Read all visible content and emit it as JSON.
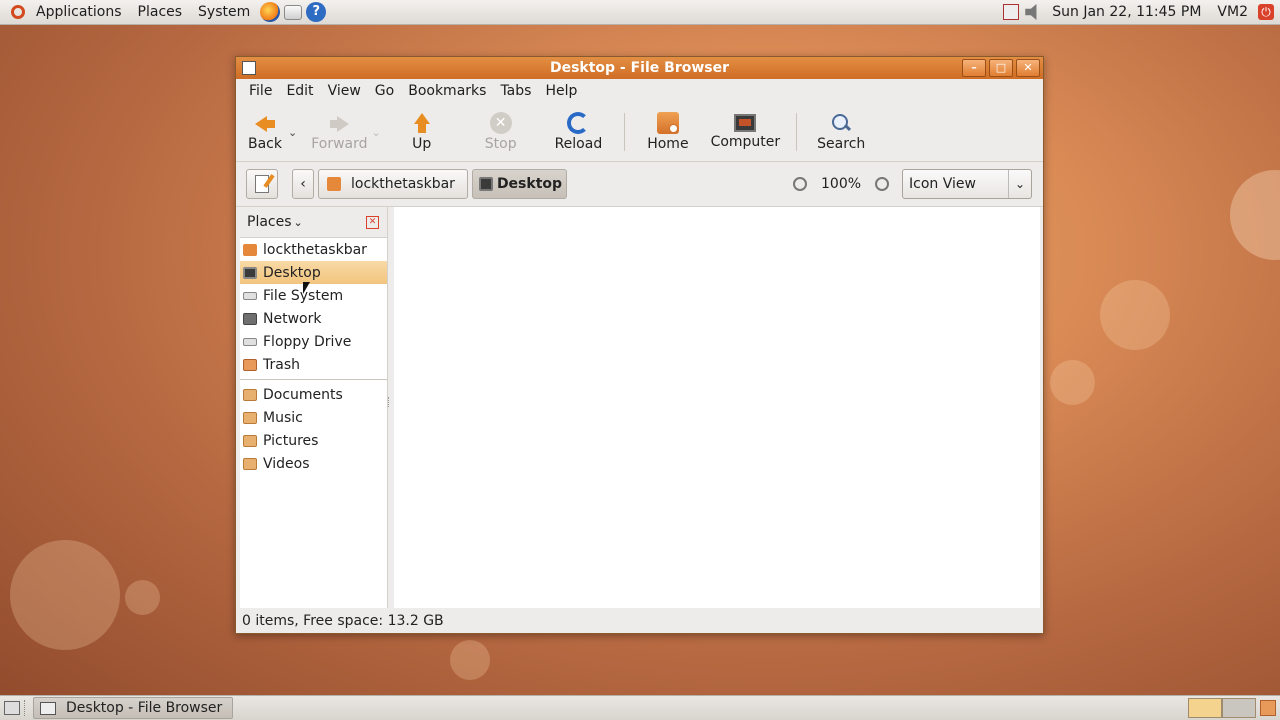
{
  "top_panel": {
    "menus": [
      "Applications",
      "Places",
      "System"
    ],
    "datetime": "Sun Jan 22, 11:45 PM",
    "user": "VM2",
    "help_glyph": "?"
  },
  "window": {
    "title": "Desktop - File Browser",
    "controls": {
      "minimize": "–",
      "maximize": "□",
      "close": "✕"
    },
    "menubar": [
      "File",
      "Edit",
      "View",
      "Go",
      "Bookmarks",
      "Tabs",
      "Help"
    ],
    "toolbar": {
      "back": "Back",
      "forward": "Forward",
      "up": "Up",
      "stop": "Stop",
      "reload": "Reload",
      "home": "Home",
      "computer": "Computer",
      "search": "Search"
    },
    "location": {
      "crumbs": [
        "lockthetaskbar",
        "Desktop"
      ],
      "prev_glyph": "‹",
      "zoom": "100%",
      "view_mode": "Icon View"
    },
    "sidepane": {
      "header": "Places",
      "places": [
        "lockthetaskbar",
        "Desktop",
        "File System",
        "Network",
        "Floppy Drive",
        "Trash"
      ],
      "bookmarks": [
        "Documents",
        "Music",
        "Pictures",
        "Videos"
      ],
      "selected": "Desktop"
    },
    "status": "0 items, Free space: 13.2 GB"
  },
  "bottom_panel": {
    "task": "Desktop - File Browser"
  }
}
